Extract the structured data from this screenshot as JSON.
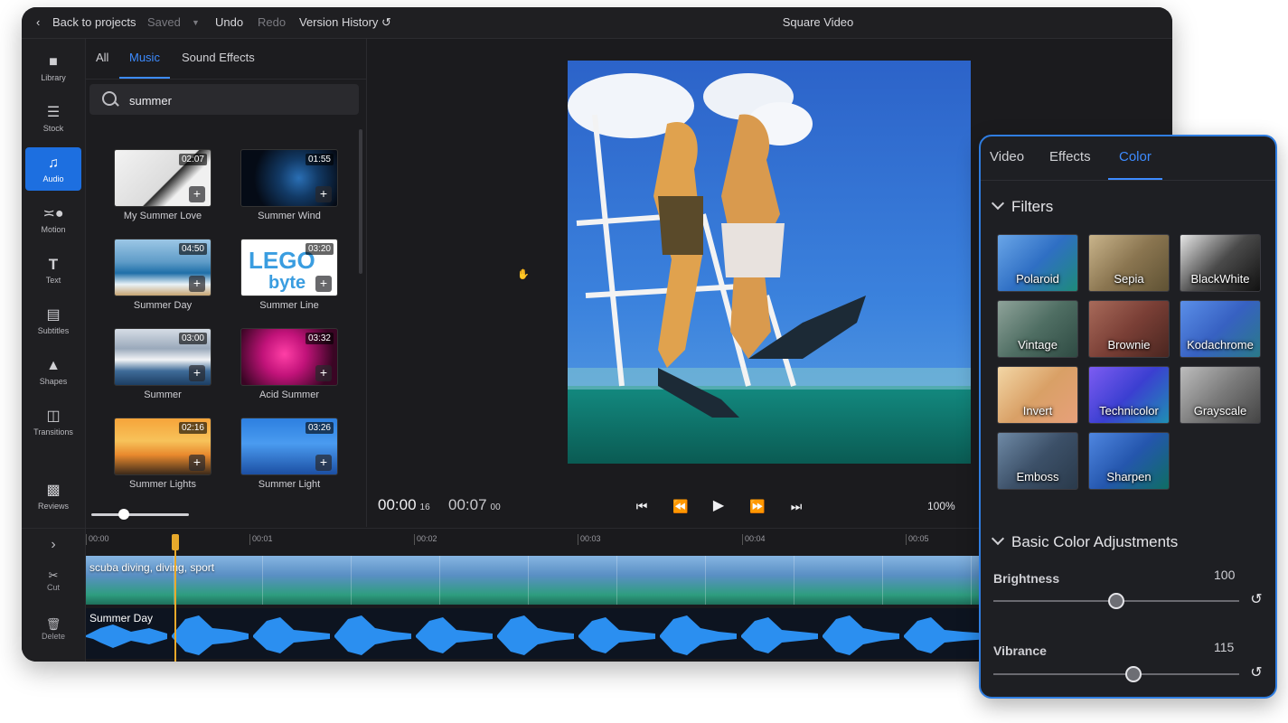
{
  "topbar": {
    "back_label": "Back to projects",
    "saved_label": "Saved",
    "undo_label": "Undo",
    "redo_label": "Redo",
    "version_history_label": "Version History",
    "project_title": "Square Video"
  },
  "rail": {
    "items": [
      {
        "label": "Library",
        "icon": "folder-icon"
      },
      {
        "label": "Stock",
        "icon": "books-icon"
      },
      {
        "label": "Audio",
        "icon": "music-note-icon",
        "active": true
      },
      {
        "label": "Motion",
        "icon": "motion-icon"
      },
      {
        "label": "Text",
        "icon": "text-icon"
      },
      {
        "label": "Subtitles",
        "icon": "subtitles-icon"
      },
      {
        "label": "Shapes",
        "icon": "shapes-icon"
      },
      {
        "label": "Transitions",
        "icon": "transitions-icon"
      },
      {
        "label": "Reviews",
        "icon": "chat-bubbles-icon"
      }
    ]
  },
  "library": {
    "tabs": [
      "All",
      "Music",
      "Sound Effects"
    ],
    "active_tab": "Music",
    "search_value": "summer",
    "tracks": [
      {
        "name": "My Summer Love",
        "duration": "02:07"
      },
      {
        "name": "Summer Wind",
        "duration": "01:55"
      },
      {
        "name": "Summer Day",
        "duration": "04:50"
      },
      {
        "name": "Summer Line",
        "duration": "03:20"
      },
      {
        "name": "Summer",
        "duration": "03:00"
      },
      {
        "name": "Acid Summer",
        "duration": "03:32"
      },
      {
        "name": "Summer Lights",
        "duration": "02:16"
      },
      {
        "name": "Summer Light",
        "duration": "03:26"
      }
    ],
    "add_symbol": "+",
    "thumbnail_size_fraction": 0.33
  },
  "preview": {
    "current_time": "00:00",
    "current_frame": "16",
    "total_time": "00:07",
    "total_frame": "00",
    "zoom": "100%"
  },
  "timeline": {
    "tools": [
      {
        "label": "Cut",
        "icon": "scissors-icon"
      },
      {
        "label": "Delete",
        "icon": "trash-icon"
      }
    ],
    "expand_icon": "chevron-right-icon",
    "ruler_ticks": [
      "00:00",
      "00:01",
      "00:02",
      "00:03",
      "00:04",
      "00:05"
    ],
    "video_clip_label": "scuba diving, diving, sport",
    "audio_clip_label": "Summer Day"
  },
  "color_panel": {
    "tabs": [
      "Video",
      "Effects",
      "Color"
    ],
    "active_tab": "Color",
    "filters_heading": "Filters",
    "filters": [
      "Polaroid",
      "Sepia",
      "BlackWhite",
      "Vintage",
      "Brownie",
      "Kodachrome",
      "Invert",
      "Technicolor",
      "Grayscale",
      "Emboss",
      "Sharpen"
    ],
    "adjustments_heading": "Basic Color Adjustments",
    "adjustments": [
      {
        "label": "Brightness",
        "value": "100",
        "level": 0.5
      },
      {
        "label": "Vibrance",
        "value": "115",
        "level": 0.57
      }
    ]
  },
  "colors": {
    "accent": "#3d8bff",
    "active_rail": "#1d6fe0",
    "playhead": "#e7a92b"
  }
}
